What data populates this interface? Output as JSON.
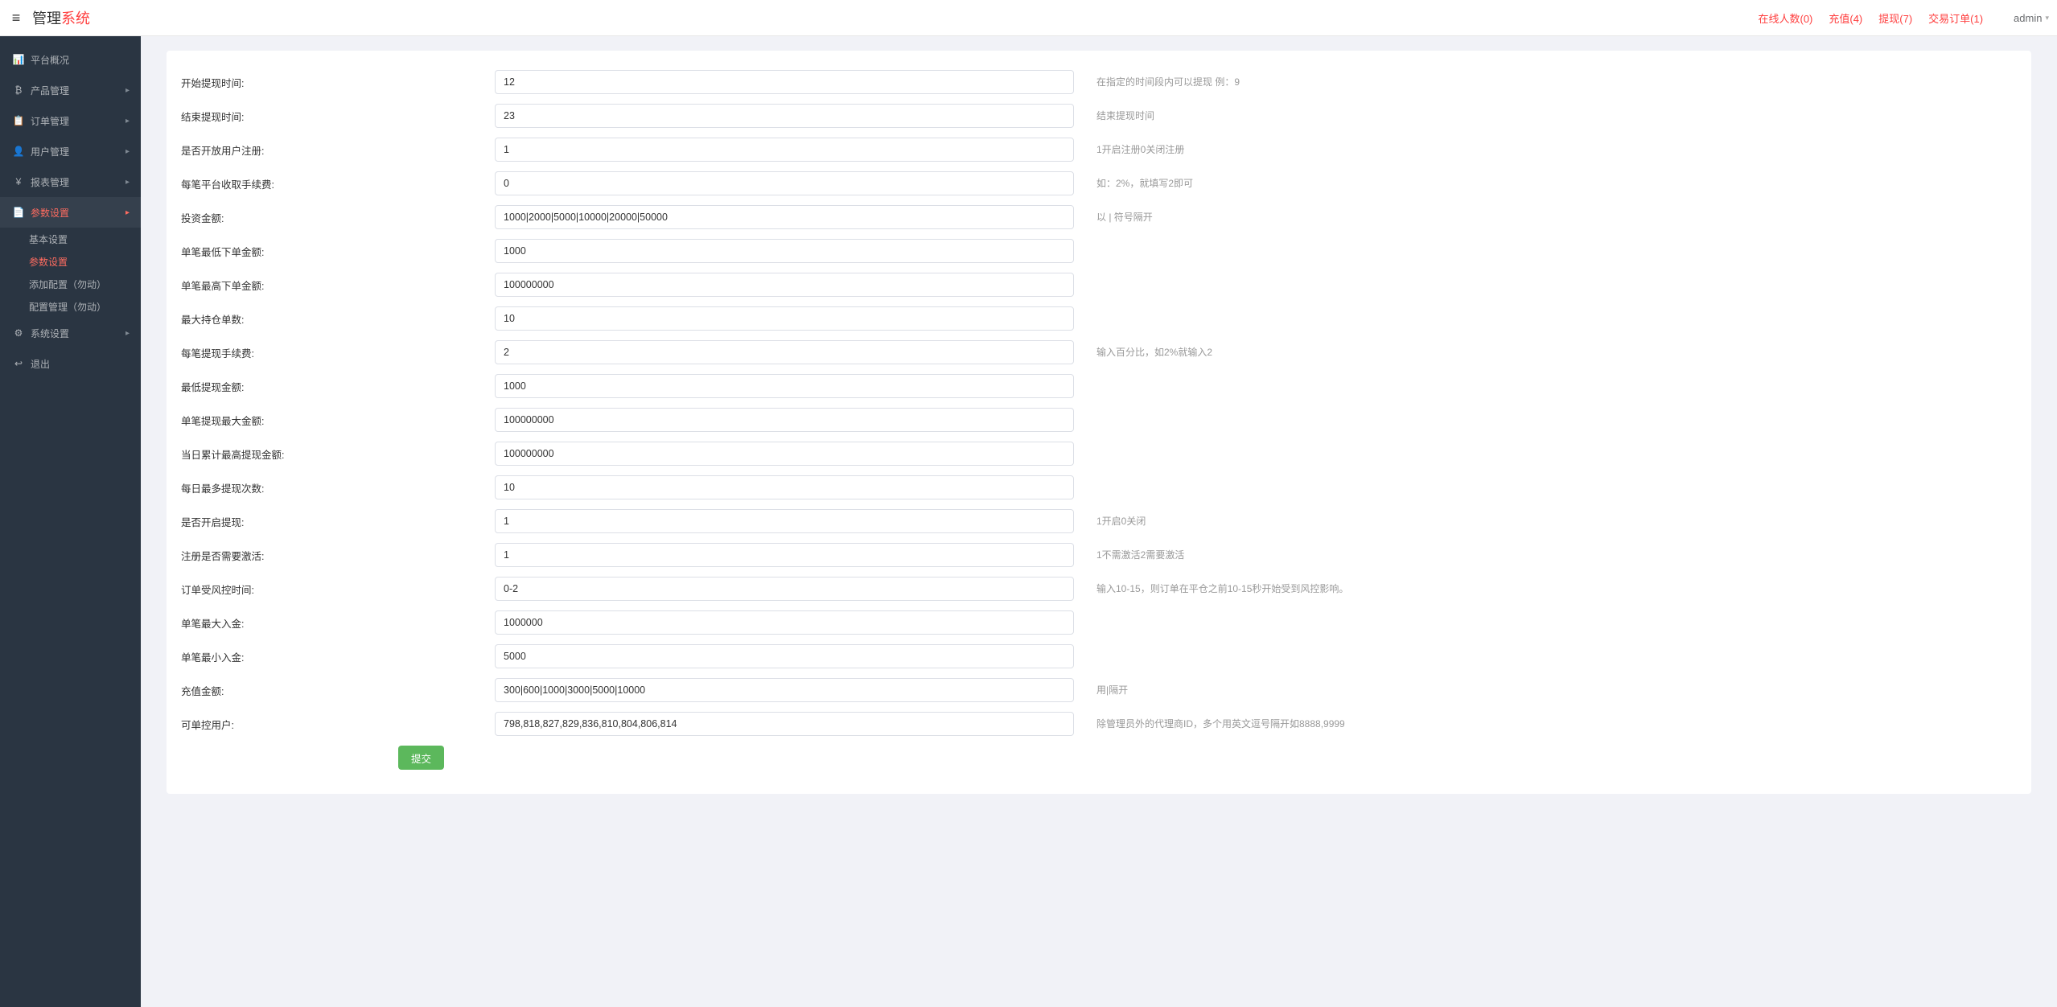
{
  "header": {
    "brand1": "管理",
    "brand2": "系统",
    "links": [
      "在线人数(0)",
      "充值(4)",
      "提现(7)",
      "交易订单(1)"
    ],
    "user": "admin"
  },
  "sidebar": {
    "items": [
      {
        "icon": "📊",
        "label": "平台概况",
        "name": "overview",
        "hasArrow": false,
        "iconRed": true
      },
      {
        "icon": "₿",
        "label": "产品管理",
        "name": "products",
        "hasArrow": true
      },
      {
        "icon": "📋",
        "label": "订单管理",
        "name": "orders",
        "hasArrow": true
      },
      {
        "icon": "👤",
        "label": "用户管理",
        "name": "users",
        "hasArrow": true
      },
      {
        "icon": "¥",
        "label": "报表管理",
        "name": "reports",
        "hasArrow": true
      },
      {
        "icon": "📄",
        "label": "参数设置",
        "name": "params",
        "hasArrow": true,
        "active": true,
        "iconRed": true
      }
    ],
    "subitems": [
      {
        "label": "基本设置",
        "name": "basic"
      },
      {
        "label": "参数设置",
        "name": "param-settings",
        "active": true
      },
      {
        "label": "添加配置（勿动）",
        "name": "add-config"
      },
      {
        "label": "配置管理（勿动）",
        "name": "config-mgmt"
      }
    ],
    "tail": [
      {
        "icon": "⚙",
        "label": "系统设置",
        "name": "system",
        "hasArrow": true
      },
      {
        "icon": "↩",
        "label": "退出",
        "name": "logout",
        "hasArrow": false
      }
    ]
  },
  "form": {
    "rows": [
      {
        "label": "开始提现时间:",
        "value": "12",
        "hint": "在指定的时间段内可以提现 例：9",
        "name": "withdraw-start"
      },
      {
        "label": "结束提现时间:",
        "value": "23",
        "hint": "结束提现时间",
        "name": "withdraw-end"
      },
      {
        "label": "是否开放用户注册:",
        "value": "1",
        "hint": "1开启注册0关闭注册",
        "name": "reg-open"
      },
      {
        "label": "每笔平台收取手续费:",
        "value": "0",
        "hint": "如：2%，就填写2即可",
        "name": "fee"
      },
      {
        "label": "投资金额:",
        "value": "1000|2000|5000|10000|20000|50000",
        "hint": "以 | 符号隔开",
        "name": "invest-amounts"
      },
      {
        "label": "单笔最低下单金额:",
        "value": "1000",
        "hint": "",
        "name": "min-order"
      },
      {
        "label": "单笔最高下单金额:",
        "value": "100000000",
        "hint": "",
        "name": "max-order"
      },
      {
        "label": "最大持仓单数:",
        "value": "10",
        "hint": "",
        "name": "max-positions"
      },
      {
        "label": "每笔提现手续费:",
        "value": "2",
        "hint": "输入百分比，如2%就输入2",
        "name": "withdraw-fee"
      },
      {
        "label": "最低提现金额:",
        "value": "1000",
        "hint": "",
        "name": "min-withdraw"
      },
      {
        "label": "单笔提现最大金额:",
        "value": "100000000",
        "hint": "",
        "name": "max-withdraw"
      },
      {
        "label": "当日累计最高提现金额:",
        "value": "100000000",
        "hint": "",
        "name": "daily-max-withdraw"
      },
      {
        "label": "每日最多提现次数:",
        "value": "10",
        "hint": "",
        "name": "daily-withdraw-count"
      },
      {
        "label": "是否开启提现:",
        "value": "1",
        "hint": "1开启0关闭",
        "name": "withdraw-enabled"
      },
      {
        "label": "注册是否需要激活:",
        "value": "1",
        "hint": "1不需激活2需要激活",
        "name": "need-activate"
      },
      {
        "label": "订单受风控时间:",
        "value": "0-2",
        "hint": "输入10-15，则订单在平仓之前10-15秒开始受到风控影响。",
        "name": "risk-window"
      },
      {
        "label": "单笔最大入金:",
        "value": "1000000",
        "hint": "",
        "name": "max-deposit"
      },
      {
        "label": "单笔最小入金:",
        "value": "5000",
        "hint": "",
        "name": "min-deposit"
      },
      {
        "label": "充值金额:",
        "value": "300|600|1000|3000|5000|10000",
        "hint": "用|隔开",
        "name": "recharge-amounts"
      },
      {
        "label": "可单控用户:",
        "value": "798,818,827,829,836,810,804,806,814",
        "hint": "除管理员外的代理商ID，多个用英文逗号隔开如8888,9999",
        "name": "controllable-users"
      }
    ],
    "submit": "提交"
  }
}
